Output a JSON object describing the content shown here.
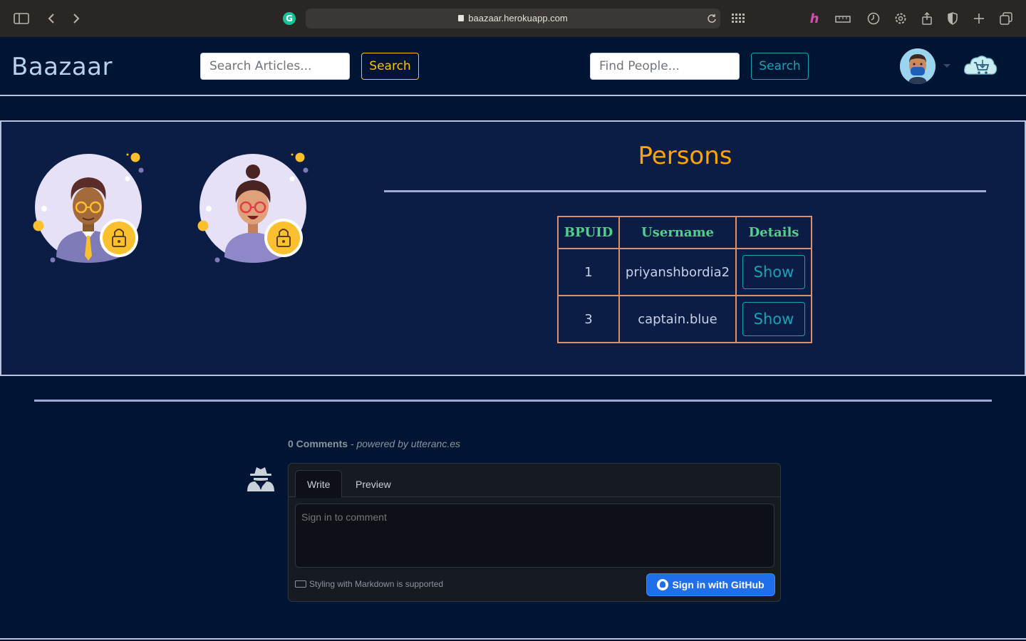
{
  "browser": {
    "url": "baazaar.herokuapp.com"
  },
  "navbar": {
    "brand": "Baazaar",
    "article_search": {
      "placeholder": "Search Articles...",
      "button": "Search"
    },
    "people_search": {
      "placeholder": "Find People...",
      "button": "Search"
    }
  },
  "persons": {
    "title": "Persons",
    "columns": [
      "BPUID",
      "Username",
      "Details"
    ],
    "rows": [
      {
        "bpuid": "1",
        "username": "priyanshbordia2",
        "action": "Show"
      },
      {
        "bpuid": "3",
        "username": "captain.blue",
        "action": "Show"
      }
    ]
  },
  "comments": {
    "count": "0 Comments",
    "powered": "- powered by utteranc.es",
    "tabs": [
      "Write",
      "Preview"
    ],
    "placeholder": "Sign in to comment",
    "markdown_note": "Styling with Markdown is supported",
    "signin_button": "Sign in with GitHub"
  },
  "colors": {
    "background": "#001533",
    "panel": "#0b1d44",
    "brand": "#b8d2ea",
    "title": "#ffa500",
    "table_header": "#4fd18b",
    "table_border": "#d9906b",
    "warning": "#ffc107",
    "info": "#17a2b8"
  }
}
